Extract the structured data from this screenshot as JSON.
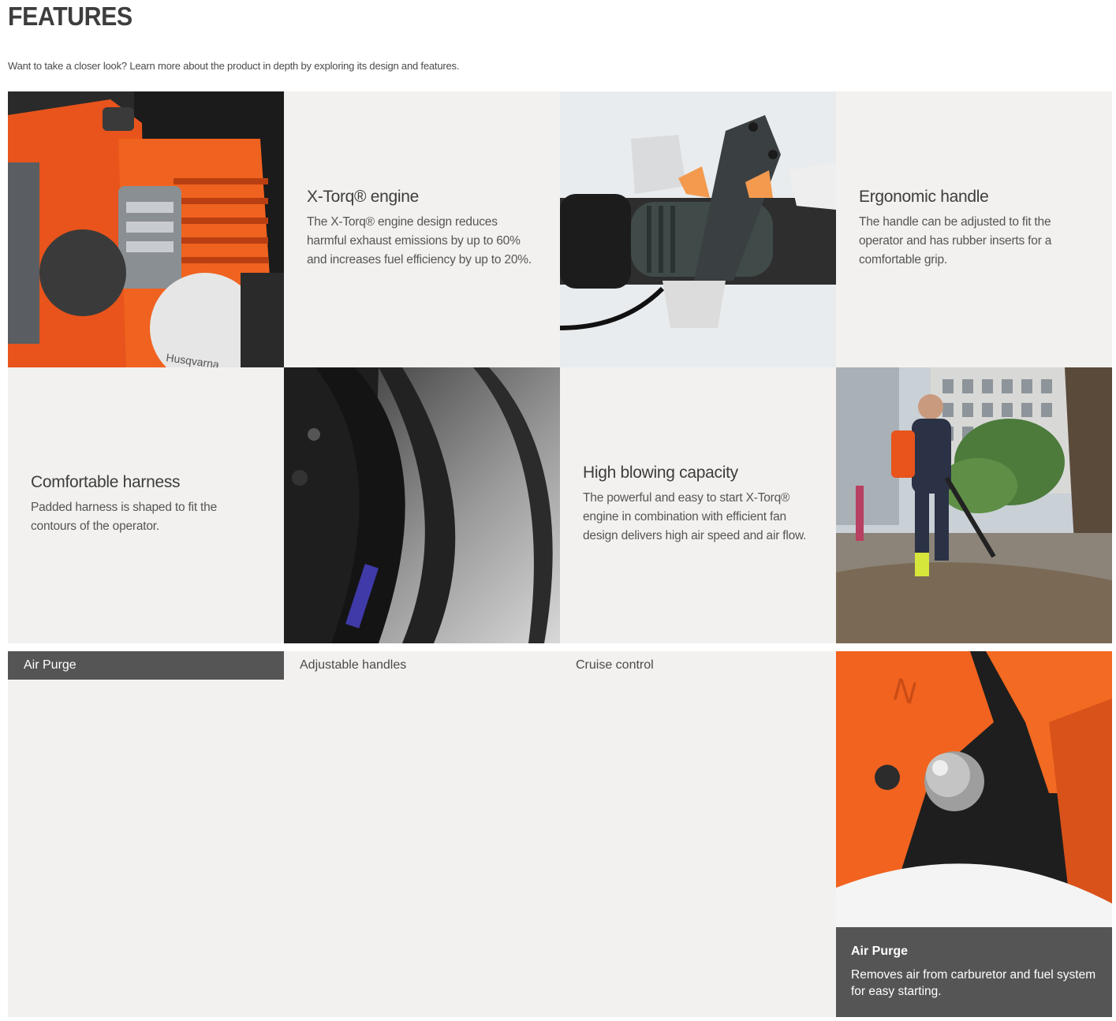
{
  "header": {
    "title": "FEATURES",
    "intro": "Want to take a closer look? Learn more about the product in depth by exploring its design and features."
  },
  "features": [
    {
      "title": "X-Torq® engine",
      "description": "The X-Torq® engine design reduces harmful exhaust emissions by up to 60% and increases fuel efficiency by up to 20%."
    },
    {
      "title": "Ergonomic handle",
      "description": "The handle can be adjusted to fit the operator and has rubber inserts for a comfortable grip."
    },
    {
      "title": "Comfortable harness",
      "description": "Padded harness is shaped to fit the contours of the operator."
    },
    {
      "title": "High blowing capacity",
      "description": "The powerful and easy to start X-Torq® engine in combination with efficient fan design delivers high air speed and air flow."
    }
  ],
  "images": {
    "engine_logo_text": "Husqvarna"
  },
  "tabs": [
    {
      "label": "Air Purge",
      "active": true
    },
    {
      "label": "Adjustable handles",
      "active": false
    },
    {
      "label": "Cruise control",
      "active": false
    }
  ],
  "active_feature": {
    "title": "Air Purge",
    "description": "Removes air from carburetor and fuel system for easy starting."
  },
  "colors": {
    "brand_orange": "#f35b1c",
    "panel_bg": "#f2f1ef",
    "tab_active_bg": "#555555"
  }
}
